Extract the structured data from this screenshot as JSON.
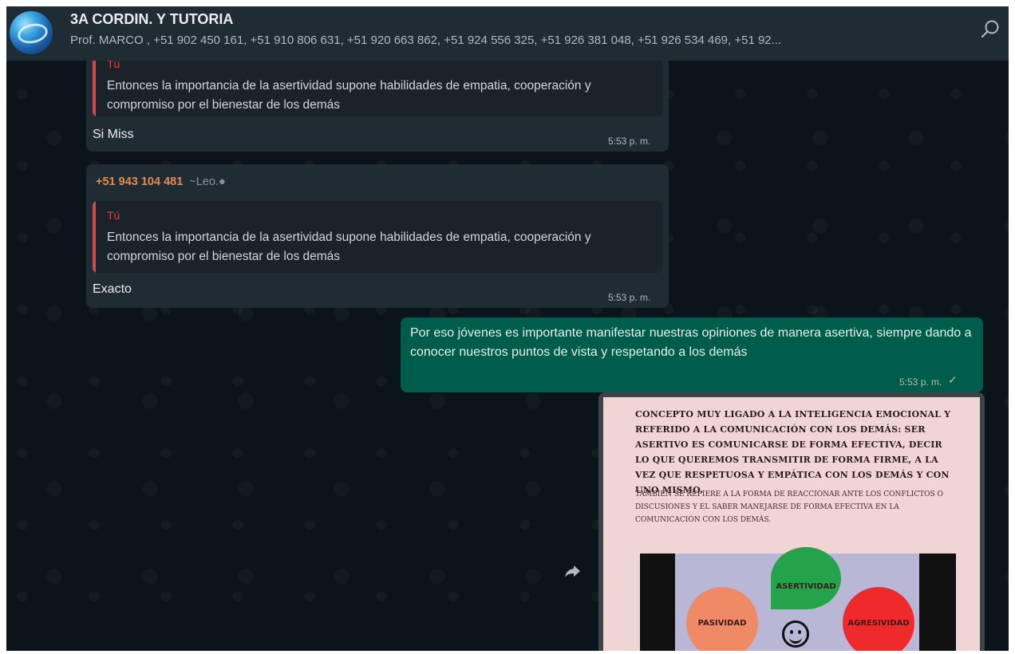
{
  "header": {
    "title": "3A CORDIN. Y TUTORIA",
    "participants": "Prof. MARCO , +51 902 450 161, +51 910 806 631, +51 920 663 862, +51 924 556 325, +51 926 381 048, +51 926 534 469, +51 92..."
  },
  "messages": [
    {
      "quote_author": "Tú",
      "quote_text": "Entonces la importancia de la asertividad supone habilidades de empatia, cooperación y compromiso por el bienestar de los demás",
      "text": "Si Miss",
      "time": "5:53 p. m."
    },
    {
      "sender_number": "+51 943 104 481",
      "sender_name": "~Leo.●",
      "quote_author": "Tú",
      "quote_text": "Entonces la importancia de la asertividad supone habilidades de empatia, cooperación y compromiso por el bienestar de los demás",
      "text": "Exacto",
      "time": "5:53 p. m."
    },
    {
      "text": "Por eso jóvenes es importante manifestar nuestras opiniones de manera asertiva, siempre dando a conocer nuestros puntos de vista y respetando a los demás",
      "time": "5:53 p. m.",
      "status_icon": "single-check-icon"
    }
  ],
  "image_message": {
    "paragraph1": "Concepto muy ligado a la inteligencia emocional y referido a la comunicación con los demás: ser asertivo es comunicarse de forma efectiva, decir lo que queremos transmitir de forma firme, a la vez que respetuosa y empática con los demás y con uno mismo.",
    "paragraph2": "También se refiere a la forma de reaccionar ante los conflictos o discusiones y el saber manejarse de forma efectiva en la comunicación con los demás.",
    "label_asertividad": "ASERTIVIDAD",
    "label_pasividad": "PASIVIDAD",
    "label_agresividad": "AGRESIVIDAD"
  },
  "colors": {
    "background": "#0b141a",
    "header": "#202c33",
    "incoming_bubble": "#202c33",
    "outgoing_bubble": "#005c4b",
    "quote_author": "#d3484a",
    "sender_number": "#e68a4e"
  }
}
